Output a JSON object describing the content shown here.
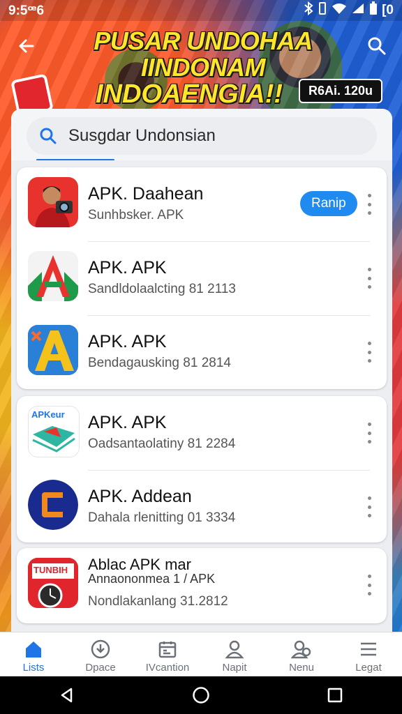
{
  "status_bar": {
    "time": "9:5ꟹ6",
    "battery": "[0"
  },
  "header": {
    "headline_line1": "PUSAR UNDOHAA IINDONAM",
    "headline_line2": "INDOAENGIA!!",
    "badge": "R6Ai. 120u",
    "back_icon": "arrow-left-icon",
    "search_icon": "search-icon"
  },
  "search": {
    "placeholder": "Susgdar Undonsian",
    "value": "Susgdar Undonsian"
  },
  "apps": [
    {
      "name": "APK. Daahean",
      "subtitle": "Sunhbsker. APK",
      "action": "Ranip",
      "icon": "person-camera-icon",
      "color": "#e8322d"
    },
    {
      "name": "APK. APK",
      "subtitle": "Sandldolaalcting 81 2113",
      "icon": "letter-a-green-icon",
      "color": "#1f9a4b"
    },
    {
      "name": "APK. APK",
      "subtitle": "Bendagausking 81 2814",
      "icon": "letter-a-yellow-icon",
      "color": "#2a7fd6"
    },
    {
      "name": "APK. APK",
      "subtitle": "Oadsantaolatiny 81 2284",
      "icon": "apkpure-map-icon",
      "color": "#2fb6a3",
      "icon_text": "APKeur"
    },
    {
      "name": "APK. Addean",
      "subtitle": "Dahala rlenitting 01 3334",
      "icon": "orange-c-icon",
      "color": "#1a2b8f"
    },
    {
      "name": "Ablac APK mar",
      "name_line2": "Annaononmea 1 / APK",
      "subtitle": "Nondlakanlang 31.2812",
      "icon": "red-badge-clock-icon",
      "color": "#e0252d",
      "icon_text": "TUNBIH"
    }
  ],
  "bottom_nav": [
    {
      "label": "Lists",
      "icon": "home-icon",
      "active": true
    },
    {
      "label": "Dpace",
      "icon": "download-circle-icon",
      "active": false
    },
    {
      "label": "IVcantion",
      "icon": "calendar-icon",
      "active": false
    },
    {
      "label": "Napit",
      "icon": "person-icon",
      "active": false
    },
    {
      "label": "Nenu",
      "icon": "people-icon",
      "active": false
    },
    {
      "label": "Legat",
      "icon": "menu-lines-icon",
      "active": false
    }
  ],
  "colors": {
    "accent": "#1f74e8",
    "action_button": "#1f8bf0",
    "headline": "#ffe62a"
  }
}
